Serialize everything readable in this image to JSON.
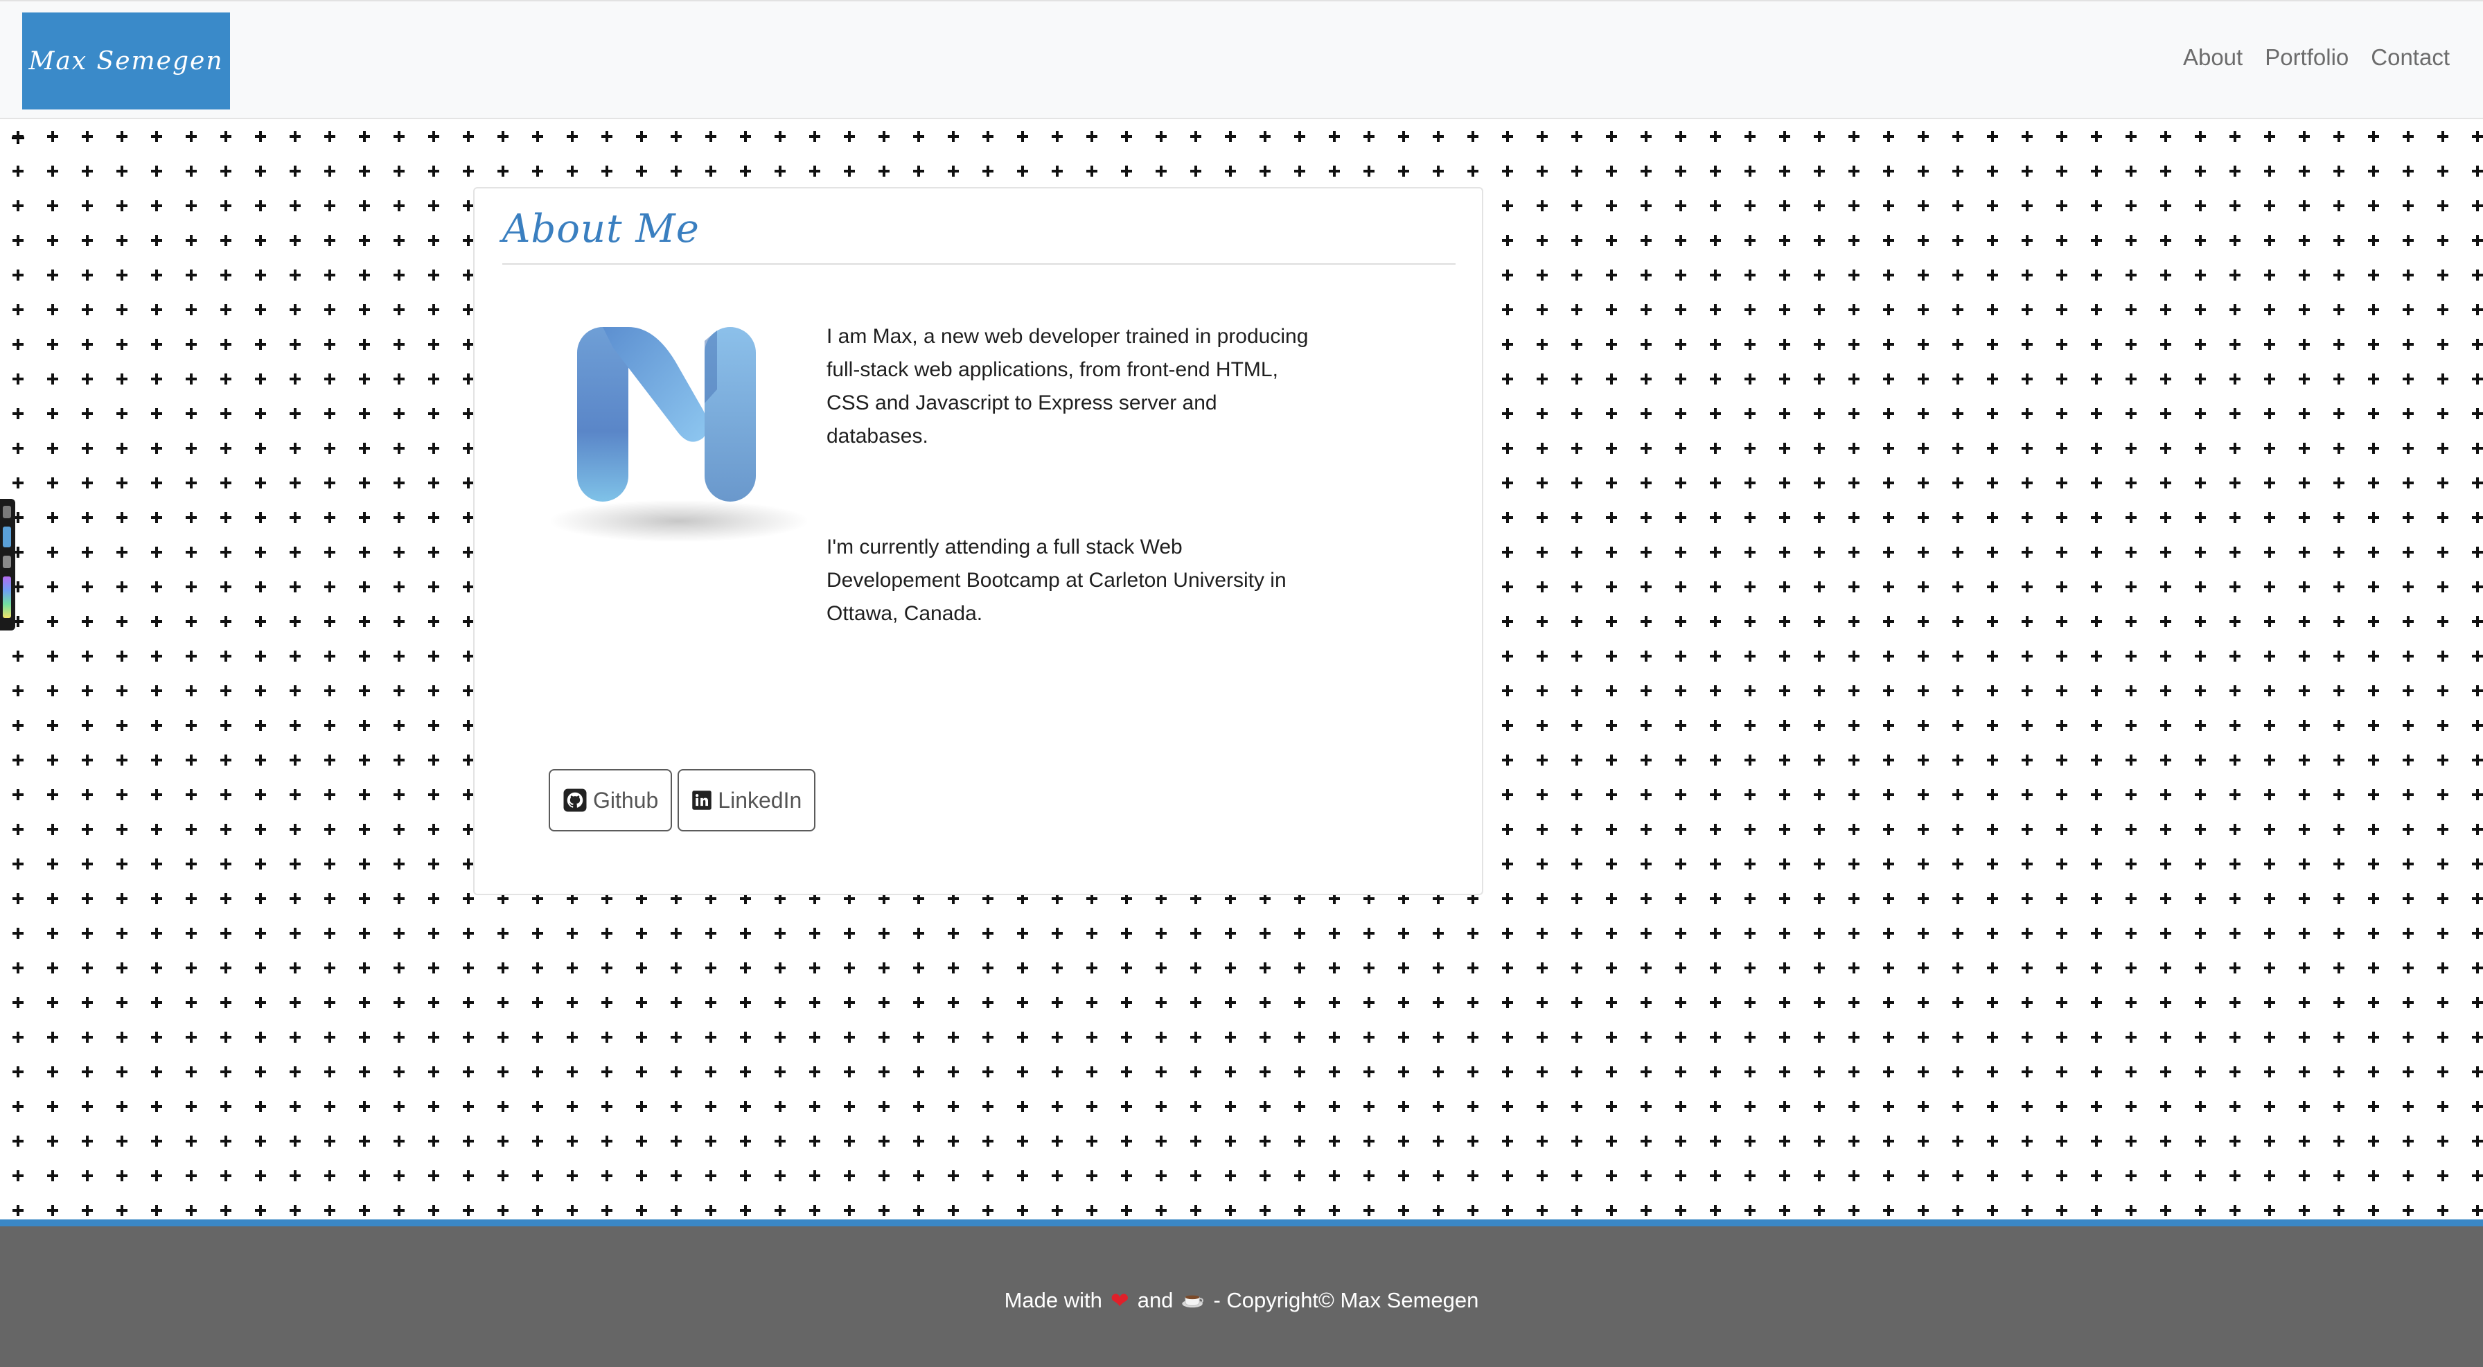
{
  "nav": {
    "brand": "Max Semegen",
    "links": [
      "About",
      "Portfolio",
      "Contact"
    ]
  },
  "about": {
    "title": "About Me",
    "paragraph_1": "I am Max, a new web developer trained in producing full-stack web applications, from front-end HTML, CSS and Javascript to Express server and databases.",
    "paragraph_2": "I'm currently attending a full stack Web Developement Bootcamp at Carleton University in Ottawa, Canada."
  },
  "social": {
    "github_label": "Github",
    "linkedin_label": "LinkedIn"
  },
  "footer": {
    "made_with": "Made with",
    "and": "and",
    "copyright": "- Copyright© Max Semegen"
  },
  "icons": {
    "logo": "m-logo-icon",
    "github": "github-icon",
    "linkedin": "linkedin-icon",
    "heart": "heart-icon",
    "coffee": "coffee-icon"
  },
  "colors": {
    "brand_blue": "#3a8ac9",
    "title_blue": "#3a7fc0",
    "footer_bg": "#666666",
    "footer_accent": "#3a87c5",
    "nav_bg": "#f8f9fa"
  }
}
